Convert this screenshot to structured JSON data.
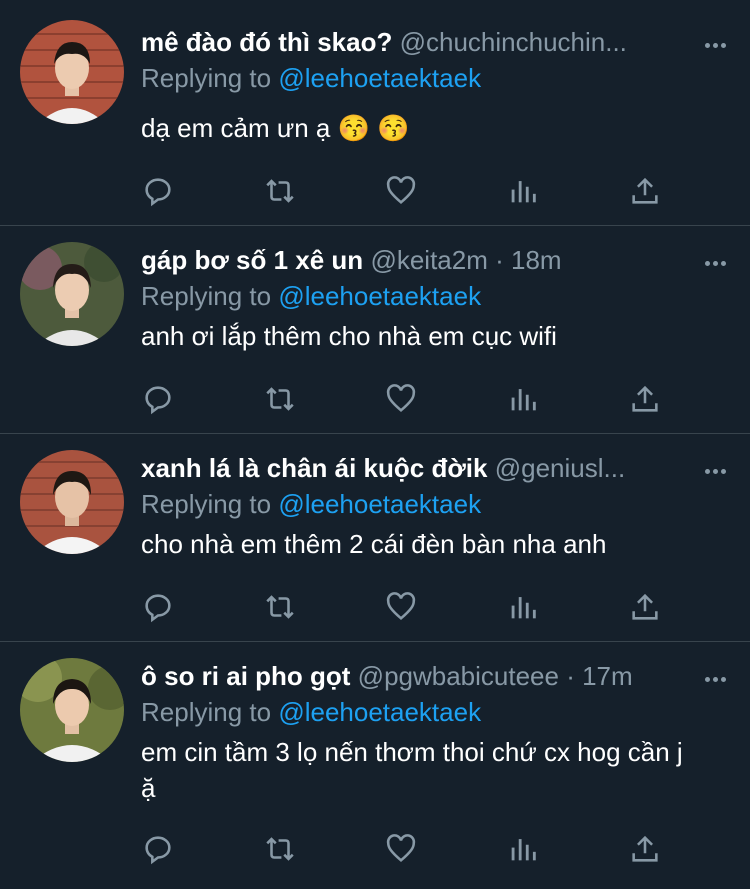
{
  "tweets": [
    {
      "display_name": "mê đào đó thì skao?",
      "handle": "@chuchinchuchin...",
      "time": "",
      "replying_label": "Replying to",
      "replying_to": "@leehoetaektaek",
      "text": "dạ em cảm ưn ạ 😚 😚",
      "avatar_bg": "#b1533e"
    },
    {
      "display_name": "gáp bơ số 1 xê un",
      "handle": "@keita2m",
      "time": "· 18m",
      "replying_label": "Replying to",
      "replying_to": "@leehoetaektaek",
      "text": "anh ơi lắp thêm cho nhà em cục wifi",
      "avatar_bg": "#5b6b4a"
    },
    {
      "display_name": "xanh lá là chân ái kuộc đờik",
      "handle": "@geniusl...",
      "time": "",
      "replying_label": "Replying to",
      "replying_to": "@leehoetaektaek",
      "text": "cho nhà em thêm 2 cái đèn bàn nha anh",
      "avatar_bg": "#a9533f"
    },
    {
      "display_name": "ô so ri ai pho gọt",
      "handle": "@pgwbabicuteee",
      "time": "· 17m",
      "replying_label": "Replying to",
      "replying_to": "@leehoetaektaek",
      "text": "em cin tầm 3 lọ nến thơm thoi chứ cx hog cần j ặ",
      "avatar_bg": "#6e7a3e"
    }
  ],
  "icons": [
    "reply-icon",
    "retweet-icon",
    "like-icon",
    "analytics-icon",
    "share-icon",
    "more-icon"
  ],
  "colors": {
    "background": "#15202b",
    "secondary_text": "#8899a6",
    "link": "#1da1f2",
    "divider": "#38444d"
  }
}
